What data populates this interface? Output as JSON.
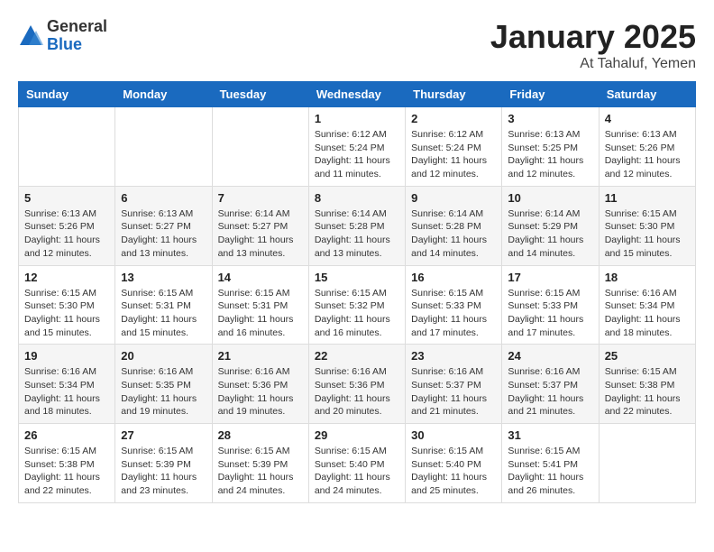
{
  "logo": {
    "general": "General",
    "blue": "Blue"
  },
  "title": "January 2025",
  "subtitle": "At Tahaluf, Yemen",
  "days_header": [
    "Sunday",
    "Monday",
    "Tuesday",
    "Wednesday",
    "Thursday",
    "Friday",
    "Saturday"
  ],
  "weeks": [
    [
      {
        "day": "",
        "info": ""
      },
      {
        "day": "",
        "info": ""
      },
      {
        "day": "",
        "info": ""
      },
      {
        "day": "1",
        "info": "Sunrise: 6:12 AM\nSunset: 5:24 PM\nDaylight: 11 hours\nand 11 minutes."
      },
      {
        "day": "2",
        "info": "Sunrise: 6:12 AM\nSunset: 5:24 PM\nDaylight: 11 hours\nand 12 minutes."
      },
      {
        "day": "3",
        "info": "Sunrise: 6:13 AM\nSunset: 5:25 PM\nDaylight: 11 hours\nand 12 minutes."
      },
      {
        "day": "4",
        "info": "Sunrise: 6:13 AM\nSunset: 5:26 PM\nDaylight: 11 hours\nand 12 minutes."
      }
    ],
    [
      {
        "day": "5",
        "info": "Sunrise: 6:13 AM\nSunset: 5:26 PM\nDaylight: 11 hours\nand 12 minutes."
      },
      {
        "day": "6",
        "info": "Sunrise: 6:13 AM\nSunset: 5:27 PM\nDaylight: 11 hours\nand 13 minutes."
      },
      {
        "day": "7",
        "info": "Sunrise: 6:14 AM\nSunset: 5:27 PM\nDaylight: 11 hours\nand 13 minutes."
      },
      {
        "day": "8",
        "info": "Sunrise: 6:14 AM\nSunset: 5:28 PM\nDaylight: 11 hours\nand 13 minutes."
      },
      {
        "day": "9",
        "info": "Sunrise: 6:14 AM\nSunset: 5:28 PM\nDaylight: 11 hours\nand 14 minutes."
      },
      {
        "day": "10",
        "info": "Sunrise: 6:14 AM\nSunset: 5:29 PM\nDaylight: 11 hours\nand 14 minutes."
      },
      {
        "day": "11",
        "info": "Sunrise: 6:15 AM\nSunset: 5:30 PM\nDaylight: 11 hours\nand 15 minutes."
      }
    ],
    [
      {
        "day": "12",
        "info": "Sunrise: 6:15 AM\nSunset: 5:30 PM\nDaylight: 11 hours\nand 15 minutes."
      },
      {
        "day": "13",
        "info": "Sunrise: 6:15 AM\nSunset: 5:31 PM\nDaylight: 11 hours\nand 15 minutes."
      },
      {
        "day": "14",
        "info": "Sunrise: 6:15 AM\nSunset: 5:31 PM\nDaylight: 11 hours\nand 16 minutes."
      },
      {
        "day": "15",
        "info": "Sunrise: 6:15 AM\nSunset: 5:32 PM\nDaylight: 11 hours\nand 16 minutes."
      },
      {
        "day": "16",
        "info": "Sunrise: 6:15 AM\nSunset: 5:33 PM\nDaylight: 11 hours\nand 17 minutes."
      },
      {
        "day": "17",
        "info": "Sunrise: 6:15 AM\nSunset: 5:33 PM\nDaylight: 11 hours\nand 17 minutes."
      },
      {
        "day": "18",
        "info": "Sunrise: 6:16 AM\nSunset: 5:34 PM\nDaylight: 11 hours\nand 18 minutes."
      }
    ],
    [
      {
        "day": "19",
        "info": "Sunrise: 6:16 AM\nSunset: 5:34 PM\nDaylight: 11 hours\nand 18 minutes."
      },
      {
        "day": "20",
        "info": "Sunrise: 6:16 AM\nSunset: 5:35 PM\nDaylight: 11 hours\nand 19 minutes."
      },
      {
        "day": "21",
        "info": "Sunrise: 6:16 AM\nSunset: 5:36 PM\nDaylight: 11 hours\nand 19 minutes."
      },
      {
        "day": "22",
        "info": "Sunrise: 6:16 AM\nSunset: 5:36 PM\nDaylight: 11 hours\nand 20 minutes."
      },
      {
        "day": "23",
        "info": "Sunrise: 6:16 AM\nSunset: 5:37 PM\nDaylight: 11 hours\nand 21 minutes."
      },
      {
        "day": "24",
        "info": "Sunrise: 6:16 AM\nSunset: 5:37 PM\nDaylight: 11 hours\nand 21 minutes."
      },
      {
        "day": "25",
        "info": "Sunrise: 6:15 AM\nSunset: 5:38 PM\nDaylight: 11 hours\nand 22 minutes."
      }
    ],
    [
      {
        "day": "26",
        "info": "Sunrise: 6:15 AM\nSunset: 5:38 PM\nDaylight: 11 hours\nand 22 minutes."
      },
      {
        "day": "27",
        "info": "Sunrise: 6:15 AM\nSunset: 5:39 PM\nDaylight: 11 hours\nand 23 minutes."
      },
      {
        "day": "28",
        "info": "Sunrise: 6:15 AM\nSunset: 5:39 PM\nDaylight: 11 hours\nand 24 minutes."
      },
      {
        "day": "29",
        "info": "Sunrise: 6:15 AM\nSunset: 5:40 PM\nDaylight: 11 hours\nand 24 minutes."
      },
      {
        "day": "30",
        "info": "Sunrise: 6:15 AM\nSunset: 5:40 PM\nDaylight: 11 hours\nand 25 minutes."
      },
      {
        "day": "31",
        "info": "Sunrise: 6:15 AM\nSunset: 5:41 PM\nDaylight: 11 hours\nand 26 minutes."
      },
      {
        "day": "",
        "info": ""
      }
    ]
  ]
}
